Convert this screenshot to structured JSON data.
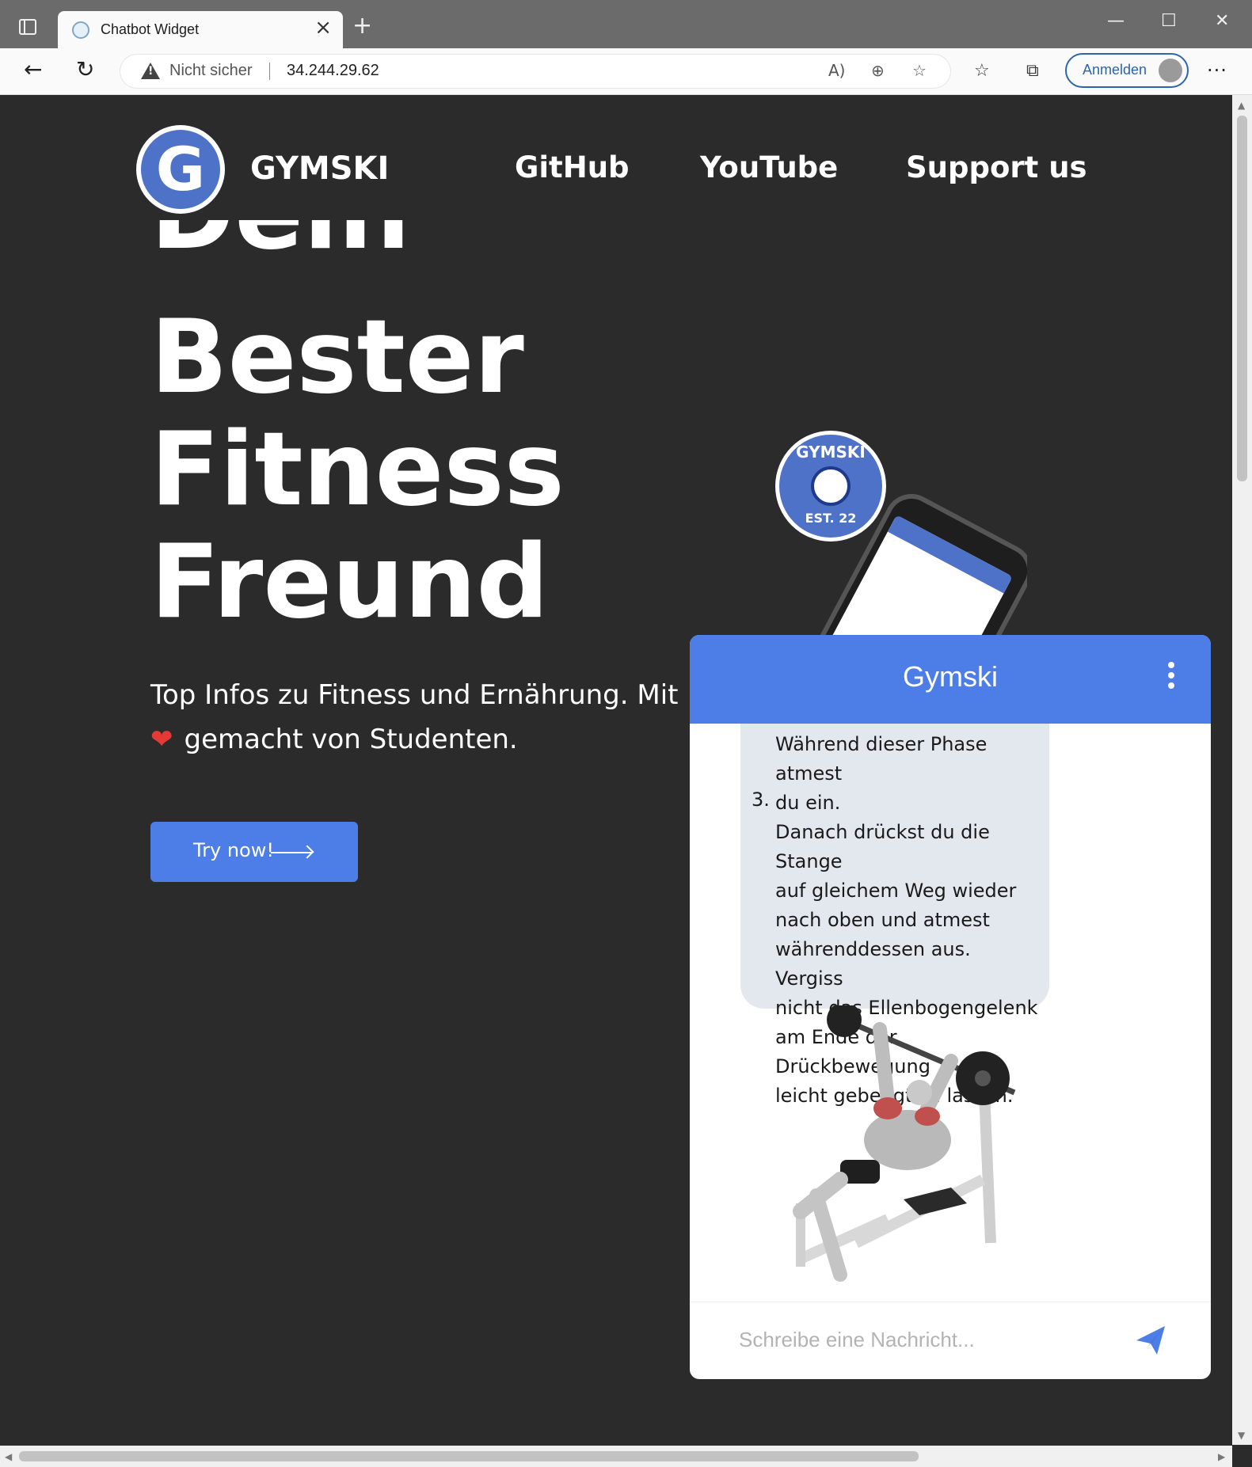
{
  "browser": {
    "tab_title": "Chatbot Widget",
    "new_tab_symbol": "+",
    "security_label": "Nicht sicher",
    "url": "34.244.29.62",
    "signin_label": "Anmelden"
  },
  "nav": {
    "brand": "GYMSKI",
    "logo_letter": "G",
    "links": [
      "GitHub",
      "YouTube",
      "Support us"
    ]
  },
  "hero": {
    "line0": "Dein",
    "line1": "Bester",
    "line2": "Fitness",
    "line3": "Freund",
    "subtitle_a": "Top Infos zu Fitness und Ernährung. Mit",
    "subtitle_b": "gemacht von Studenten.",
    "button_label": "Try now!"
  },
  "badge": {
    "top": "GYMSKI",
    "bottom": "EST. 22"
  },
  "chat": {
    "title": "Gymski",
    "message_lines": [
      "Während dieser Phase atmest",
      "du ein.",
      "Danach drückst du die Stange",
      "auf gleichem Weg wieder",
      "nach oben und atmest",
      "währenddessen aus. Vergiss",
      "nicht das Ellenbogengelenk",
      "am Ende der Drückbewegung",
      "leicht gebeugt zu lassen."
    ],
    "list_number": "3.",
    "input_placeholder": "Schreibe eine Nachricht..."
  },
  "colors": {
    "accent": "#4d7ee8",
    "logo_blue": "#4d72c8",
    "page_bg": "#2b2b2b",
    "heart": "#e53935"
  },
  "icons": [
    "sidebar-toggle-icon",
    "close-icon",
    "back-icon",
    "reload-icon",
    "warning-icon",
    "read-aloud-icon",
    "zoom-icon",
    "add-favorite-icon",
    "favorites-icon",
    "collections-icon",
    "more-icon",
    "menu-kebab-icon",
    "send-icon",
    "heart-icon",
    "arrow-right-icon"
  ]
}
